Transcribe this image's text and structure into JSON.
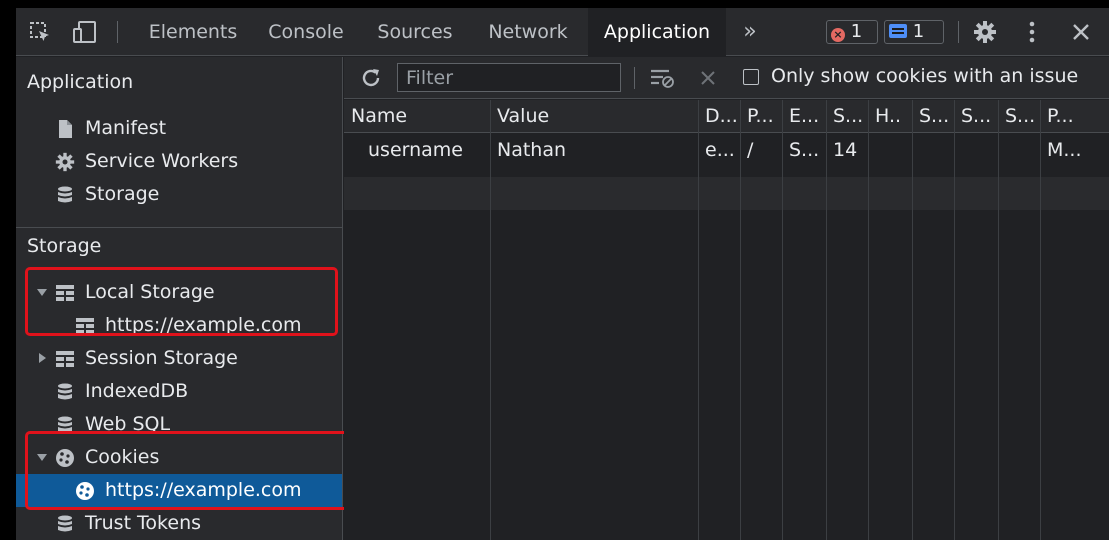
{
  "tabs": {
    "elements": "Elements",
    "console": "Console",
    "sources": "Sources",
    "network": "Network",
    "application": "Application",
    "more": "»"
  },
  "badges": {
    "errors": "1",
    "messages": "1"
  },
  "sidebar": {
    "app_header": "Application",
    "manifest": "Manifest",
    "service_workers": "Service Workers",
    "storage_item": "Storage",
    "storage_header": "Storage",
    "local_storage": "Local Storage",
    "local_storage_origin": "https://example.com",
    "session_storage": "Session Storage",
    "indexeddb": "IndexedDB",
    "websql": "Web SQL",
    "cookies": "Cookies",
    "cookies_origin": "https://example.com",
    "trust_tokens": "Trust Tokens"
  },
  "toolbar": {
    "filter_placeholder": "Filter",
    "only_issues_label": "Only show cookies with an issue"
  },
  "table": {
    "columns": [
      "Name",
      "Value",
      "D...",
      "P...",
      "E...",
      "S...",
      "H..",
      "S...",
      "S...",
      "S...",
      "P..."
    ],
    "rows": [
      [
        "username",
        "Nathan",
        "e...",
        "/",
        "S...",
        "14",
        "",
        "",
        "",
        "",
        "M..."
      ]
    ]
  },
  "colors": {
    "selected": "#0f5a99",
    "highlight": "#e0121b",
    "error": "#e46962",
    "info": "#4e8ef7"
  }
}
